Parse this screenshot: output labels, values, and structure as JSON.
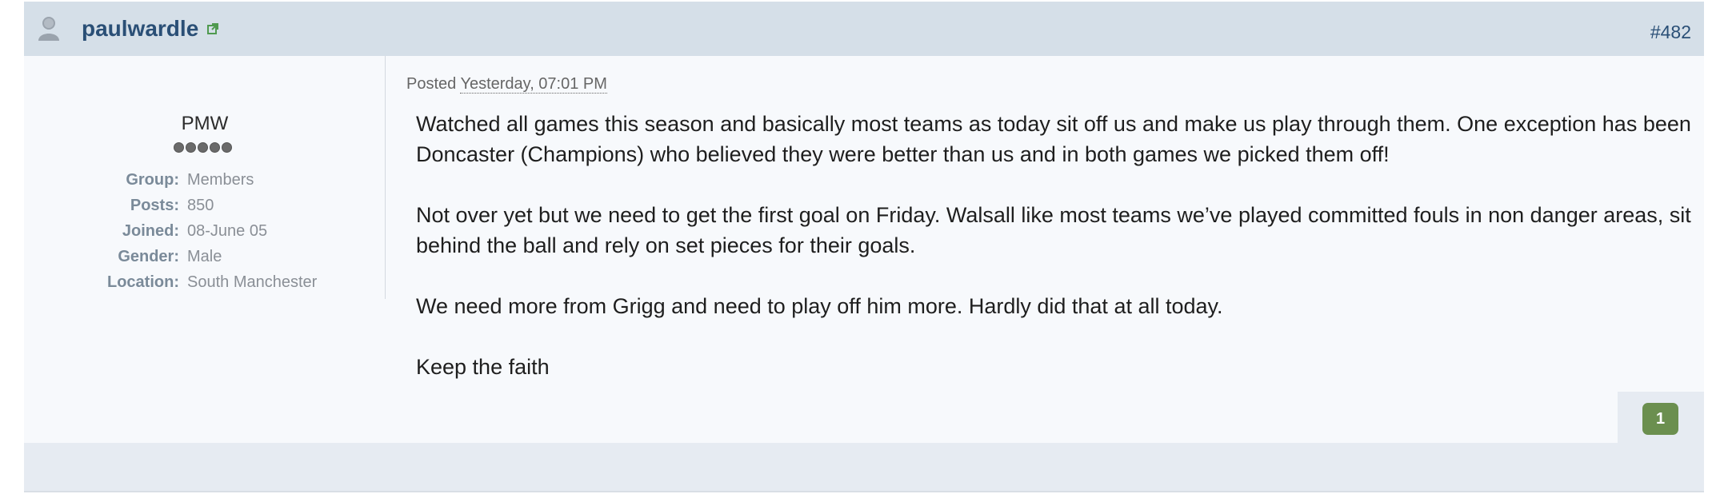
{
  "post": {
    "author": {
      "username": "paulwardle",
      "member_title": "PMW",
      "rank_pips": 5,
      "info": [
        {
          "label": "Group:",
          "value": "Members"
        },
        {
          "label": "Posts:",
          "value": "850"
        },
        {
          "label": "Joined:",
          "value": "08-June 05"
        },
        {
          "label": "Gender:",
          "value": "Male"
        },
        {
          "label": "Location:",
          "value": "South Manchester"
        }
      ]
    },
    "post_number": "#482",
    "posted_prefix": "Posted",
    "posted_date": "Yesterday, 07:01 PM",
    "body": [
      "Watched all games this season and basically most teams as today sit off us and make us play through them. One exception has been Doncaster (Champions) who believed they were better than us and in both games we picked them off!",
      "Not over yet but we need to get the first goal on Friday. Walsall like most teams we’ve played committed fouls in non danger areas, sit behind the ball and rely on set pieces for their goals.",
      "We need more from Grigg and need to play off him more. Hardly did that at all today.",
      "Keep the faith"
    ],
    "reputation": "1"
  },
  "icons": {
    "avatar": "user-silhouette-icon",
    "online": "external-link-icon"
  },
  "colors": {
    "header_bg": "#d5dfe8",
    "username": "#2a4f76",
    "reputation_badge": "#6b8f4f"
  }
}
